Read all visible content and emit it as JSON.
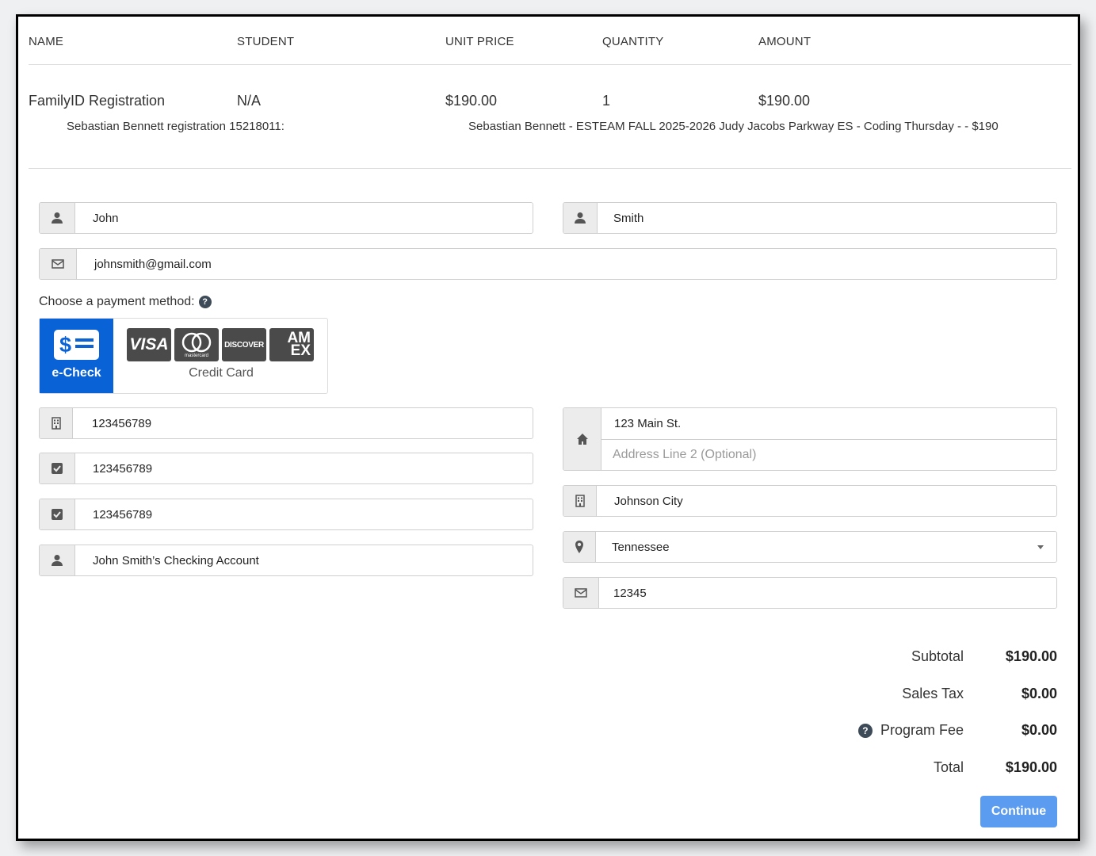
{
  "table": {
    "headers": [
      "NAME",
      "STUDENT",
      "UNIT PRICE",
      "QUANTITY",
      "AMOUNT"
    ],
    "row": {
      "name": "FamilyID Registration",
      "student": "N/A",
      "unit_price": "$190.00",
      "quantity": "1",
      "amount": "$190.00"
    },
    "detail_left": "Sebastian Bennett registration 15218011:",
    "detail_right": "Sebastian Bennett - ESTEAM FALL 2025-2026 Judy Jacobs Parkway ES - Coding Thursday - - $190"
  },
  "contact": {
    "first_name": "John",
    "last_name": "Smith",
    "email": "johnsmith@gmail.com"
  },
  "payment": {
    "label": "Choose a payment method:",
    "echeck_label": "e-Check",
    "credit_card_label": "Credit Card",
    "card_brands": [
      "VISA",
      "mastercard",
      "DISCOVER",
      "AM EX"
    ],
    "selected": "e-Check"
  },
  "bank": {
    "routing_number": "123456789",
    "account_number": "123456789",
    "confirm_account_number": "123456789",
    "account_name": "John Smith’s Checking Account"
  },
  "address": {
    "line1": "123 Main St.",
    "line2_placeholder": "Address Line 2 (Optional)",
    "city": "Johnson City",
    "state": "Tennessee",
    "zip": "12345"
  },
  "totals": {
    "subtotal_label": "Subtotal",
    "subtotal": "$190.00",
    "tax_label": "Sales Tax",
    "tax": "$0.00",
    "fee_label": "Program Fee",
    "fee": "$0.00",
    "total_label": "Total",
    "total": "$190.00"
  },
  "continue_label": "Continue",
  "colors": {
    "accent": "#0a63d6",
    "continue": "#5b9cf0"
  }
}
